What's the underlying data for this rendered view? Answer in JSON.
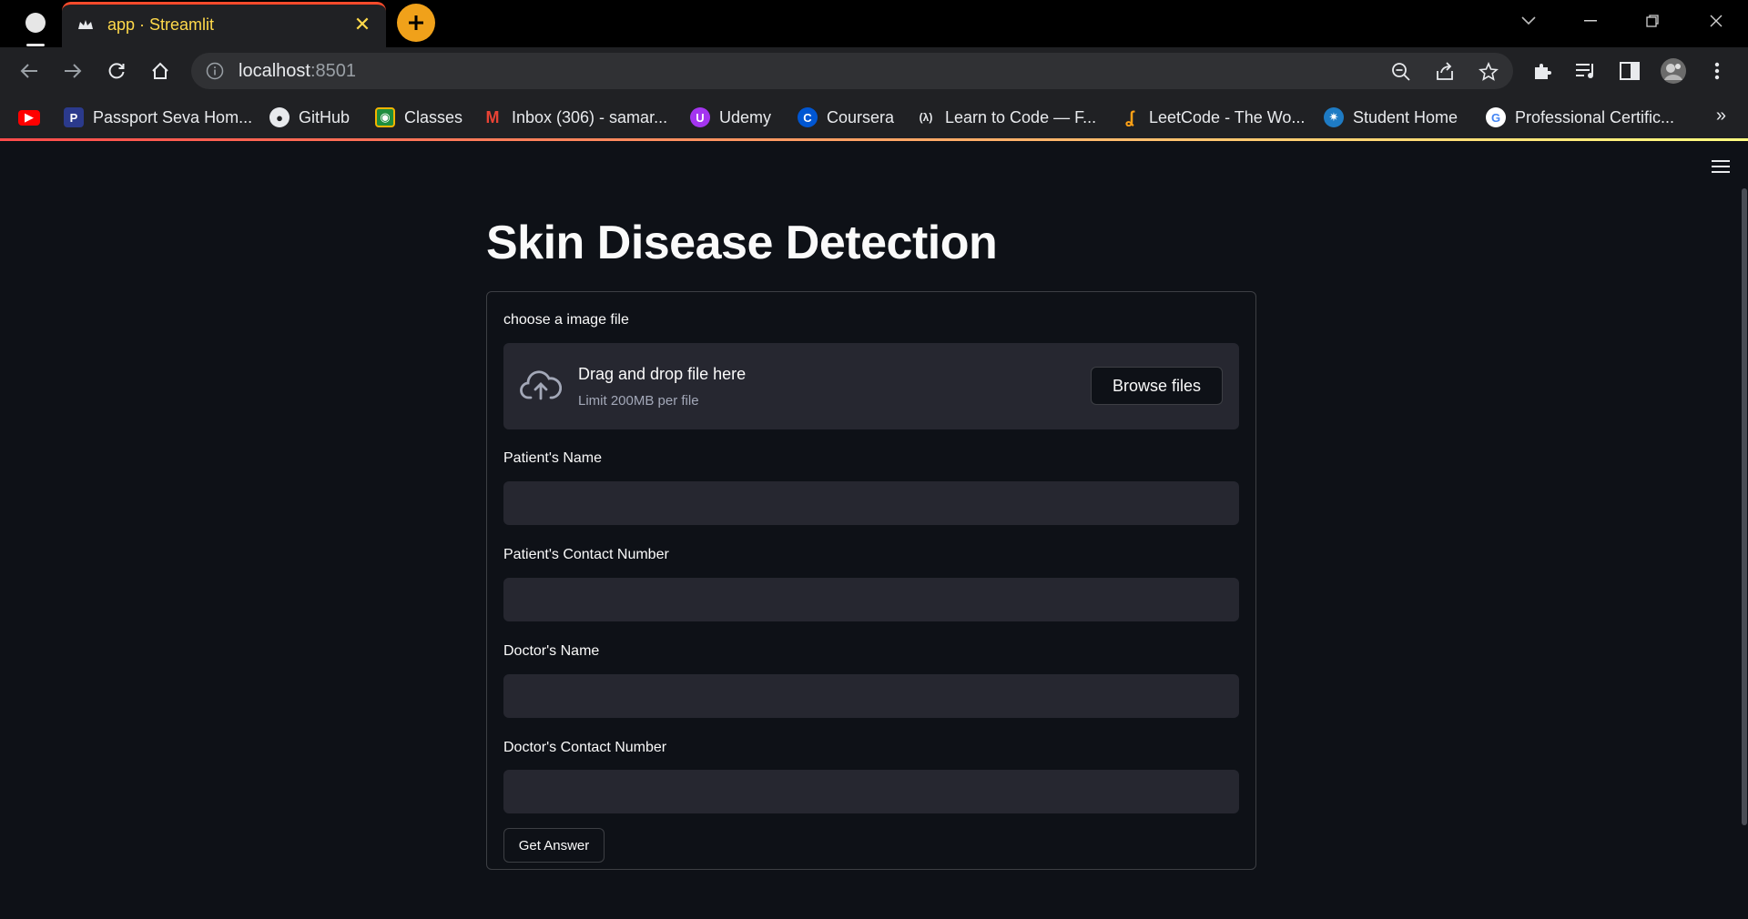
{
  "browser": {
    "tab_title": "app · Streamlit",
    "tab_close": "✕",
    "url_host": "localhost",
    "url_port": ":8501",
    "bookmarks": [
      {
        "label": "",
        "icon": "youtube-icon",
        "color": "#ff0000"
      },
      {
        "label": "Passport Seva Hom...",
        "icon": "passport-seva-icon",
        "color": "#2b3a8c"
      },
      {
        "label": "GitHub",
        "icon": "github-icon",
        "color": "#e8eaed"
      },
      {
        "label": "Classes",
        "icon": "google-classroom-icon",
        "color": "#f4b400"
      },
      {
        "label": "Inbox (306) - samar...",
        "icon": "gmail-icon",
        "color": "#ea4335"
      },
      {
        "label": "Udemy",
        "icon": "udemy-icon",
        "color": "#a435f0"
      },
      {
        "label": "Coursera",
        "icon": "coursera-icon",
        "color": "#0056d2"
      },
      {
        "label": "Learn to Code — F...",
        "icon": "freecodecamp-icon",
        "color": "#0a0a23"
      },
      {
        "label": "LeetCode - The Wo...",
        "icon": "leetcode-icon",
        "color": "#ffa116"
      },
      {
        "label": "Student Home",
        "icon": "student-home-icon",
        "color": "#1e7bc4"
      },
      {
        "label": "Professional Certific...",
        "icon": "google-icon",
        "color": "#4285f4"
      }
    ],
    "bookmarks_overflow": "»"
  },
  "app": {
    "title": "Skin Disease Detection",
    "uploader": {
      "label": "choose a image file",
      "drag_text": "Drag and drop file here",
      "limit_text": "Limit 200MB per file",
      "browse_label": "Browse files"
    },
    "fields": [
      {
        "label": "Patient's Name",
        "value": ""
      },
      {
        "label": "Patient's Contact Number",
        "value": ""
      },
      {
        "label": "Doctor's Name",
        "value": ""
      },
      {
        "label": "Doctor's Contact Number",
        "value": ""
      }
    ],
    "submit_label": "Get Answer"
  },
  "colors": {
    "background": "#0e1117",
    "input_bg": "#262730",
    "text": "#fafafa",
    "tab_title": "#ffd94a",
    "accent_newtab": "#f0a11a"
  }
}
